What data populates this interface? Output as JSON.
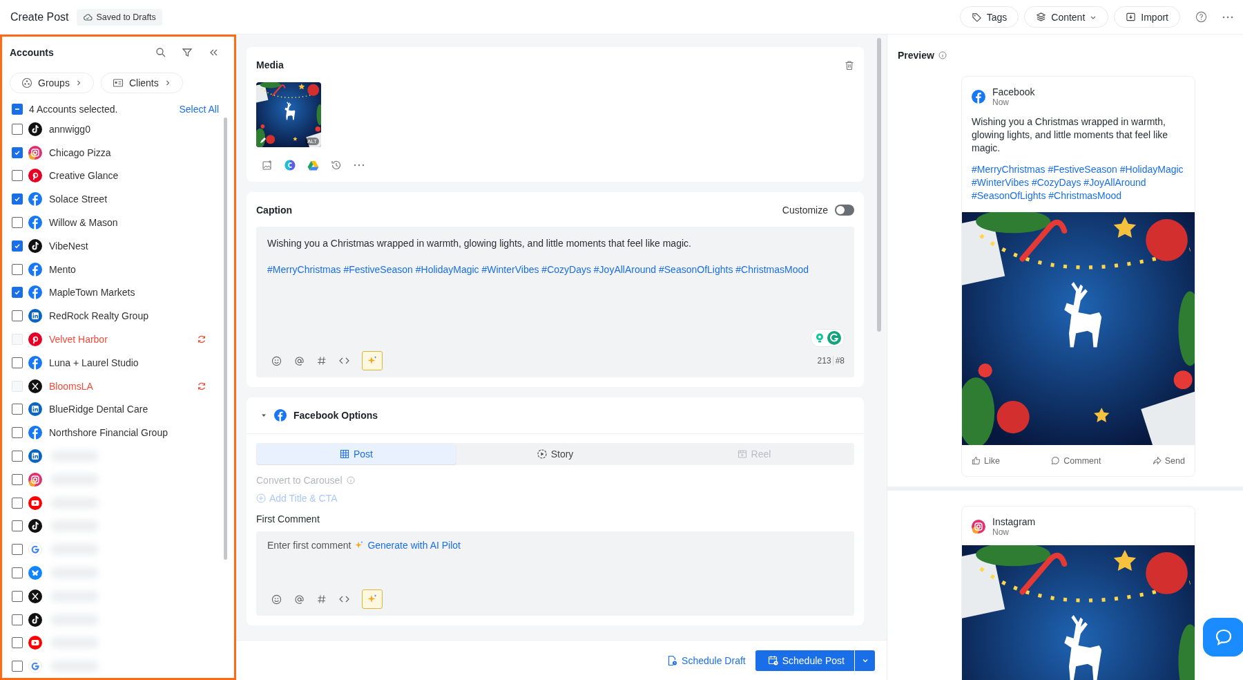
{
  "header": {
    "title": "Create Post",
    "save_status": "Saved to Drafts",
    "actions": [
      {
        "label": "Tags",
        "kind": "tags"
      },
      {
        "label": "Content",
        "kind": "content"
      },
      {
        "label": "Import",
        "kind": "import"
      }
    ]
  },
  "accounts": {
    "title": "Accounts",
    "filters": [
      {
        "label": "Groups",
        "kind": "groups"
      },
      {
        "label": "Clients",
        "kind": "clients"
      }
    ],
    "summary": "4 Accounts selected.",
    "indeterminate": true,
    "select_all": "Select All",
    "items": [
      {
        "name": "annwigg0",
        "kind": "tiktok",
        "checked": false,
        "error": false
      },
      {
        "name": "Chicago Pizza",
        "kind": "instagram",
        "checked": true,
        "error": false
      },
      {
        "name": "Creative Glance",
        "kind": "pinterest",
        "checked": false,
        "error": false
      },
      {
        "name": "Solace Street",
        "kind": "facebook",
        "checked": true,
        "error": false
      },
      {
        "name": "Willow & Mason",
        "kind": "facebook",
        "checked": false,
        "error": false
      },
      {
        "name": "VibeNest",
        "kind": "tiktok",
        "checked": true,
        "error": false
      },
      {
        "name": "Mento",
        "kind": "facebook",
        "checked": false,
        "error": false
      },
      {
        "name": "MapleTown Markets",
        "kind": "facebook",
        "checked": true,
        "error": false
      },
      {
        "name": "RedRock Realty Group",
        "kind": "linkedin",
        "checked": false,
        "error": false
      },
      {
        "name": "Velvet Harbor",
        "kind": "pinterest",
        "checked": false,
        "error": true
      },
      {
        "name": "Luna + Laurel Studio",
        "kind": "facebook",
        "checked": false,
        "error": false
      },
      {
        "name": "BloomsLA",
        "kind": "x",
        "checked": false,
        "error": true
      },
      {
        "name": "BlueRidge Dental Care",
        "kind": "linkedin",
        "checked": false,
        "error": false
      },
      {
        "name": "Northshore Financial Group",
        "kind": "facebook",
        "checked": false,
        "error": false
      },
      {
        "kind": "linkedin",
        "checked": false,
        "error": false
      },
      {
        "kind": "instagram",
        "checked": false,
        "error": false
      },
      {
        "kind": "youtube",
        "checked": false,
        "error": false
      },
      {
        "kind": "tiktok",
        "checked": false,
        "error": false
      },
      {
        "kind": "google",
        "checked": false,
        "error": false
      },
      {
        "kind": "bluesky",
        "checked": false,
        "error": false
      },
      {
        "kind": "x",
        "checked": false,
        "error": false
      },
      {
        "kind": "tiktok",
        "checked": false,
        "error": false
      },
      {
        "kind": "youtube",
        "checked": false,
        "error": false
      },
      {
        "kind": "google",
        "checked": false,
        "error": false
      }
    ]
  },
  "media": {
    "title": "Media",
    "alt_badge": "ALT"
  },
  "caption": {
    "title": "Caption",
    "customize": {
      "label": "Customize",
      "on": false
    },
    "text": "Wishing you a Christmas wrapped in warmth, glowing lights, and little moments that feel like magic.",
    "hashtags": "#MerryChristmas #FestiveSeason #HolidayMagic #WinterVibes #CozyDays #JoyAllAround #SeasonOfLights #ChristmasMood",
    "char_count": "213",
    "hashtag_count": "#8"
  },
  "facebook_options": {
    "title": "Facebook Options",
    "expanded": true,
    "tabs": [
      {
        "label": "Post",
        "kind": "grid",
        "selected": true,
        "disabled": false
      },
      {
        "label": "Story",
        "kind": "play",
        "selected": false,
        "disabled": false
      },
      {
        "label": "Reel",
        "kind": "film",
        "selected": false,
        "disabled": true
      }
    ],
    "convert_carousel": {
      "label": "Convert to Carousel",
      "disabled": true
    },
    "add_title_cta": {
      "label": "Add Title & CTA",
      "disabled": true
    },
    "first_comment": {
      "label": "First Comment",
      "placeholder": "Enter first comment",
      "ai_link": "Generate with AI Pilot"
    }
  },
  "footer": {
    "draft": "Schedule Draft",
    "schedule": "Schedule Post"
  },
  "preview": {
    "title": "Preview",
    "posts": [
      {
        "kind": "facebook",
        "name": "Facebook",
        "time": "Now",
        "text": "Wishing you a Christmas wrapped in warmth, glowing lights, and little moments that feel like magic.",
        "hashtags": "#MerryChristmas #FestiveSeason #HolidayMagic #WinterVibes #CozyDays #JoyAllAround #SeasonOfLights #ChristmasMood",
        "actions": [
          {
            "label": "Like",
            "kind": "like"
          },
          {
            "label": "Comment",
            "kind": "comment"
          },
          {
            "label": "Send",
            "kind": "send"
          }
        ]
      },
      {
        "kind": "instagram",
        "name": "Instagram",
        "time": "Now"
      }
    ]
  }
}
